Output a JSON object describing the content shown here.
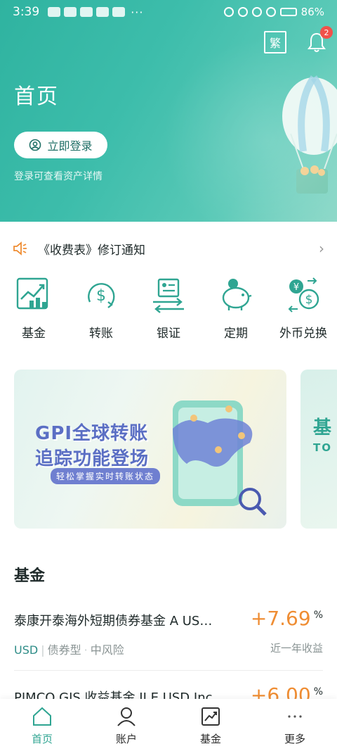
{
  "status_bar": {
    "time": "3:39",
    "battery": "86%",
    "overflow": "···"
  },
  "header": {
    "lang_toggle": "繁",
    "notification_count": "2",
    "title": "首页",
    "login_button": "立即登录",
    "login_hint": "登录可查看资产详情"
  },
  "notice": {
    "text": "《收费表》修订通知"
  },
  "quick_menu": [
    {
      "label": "基金",
      "icon": "fund-chart-icon"
    },
    {
      "label": "转账",
      "icon": "transfer-dollar-icon"
    },
    {
      "label": "银证",
      "icon": "bank-securities-icon"
    },
    {
      "label": "定期",
      "icon": "piggy-bank-icon"
    },
    {
      "label": "外币兑换",
      "icon": "currency-exchange-icon"
    }
  ],
  "banner": {
    "line1": "GPI全球转账",
    "line2": "追踪功能登场",
    "sub": "轻松掌握实时转账状态",
    "next_line1": "基",
    "next_line2": "TO"
  },
  "fund_section": {
    "title": "基金",
    "items": [
      {
        "name": "泰康开泰海外短期债券基金 A US…",
        "return": "+7.69",
        "unit": "%",
        "currency": "USD",
        "type": "债券型",
        "risk": "中风险",
        "period": "近一年收益"
      },
      {
        "name": "PIMCO GIS 收益基金 II E USD Inc",
        "return": "+6.00",
        "unit": "%"
      }
    ]
  },
  "tabbar": [
    {
      "label": "首页",
      "icon": "home-icon",
      "active": true
    },
    {
      "label": "账户",
      "icon": "account-icon",
      "active": false
    },
    {
      "label": "基金",
      "icon": "fund-icon",
      "active": false
    },
    {
      "label": "更多",
      "icon": "more-icon",
      "active": false
    }
  ],
  "colors": {
    "accent": "#2fa592",
    "return": "#ef8d33",
    "badge": "#f0524b"
  }
}
